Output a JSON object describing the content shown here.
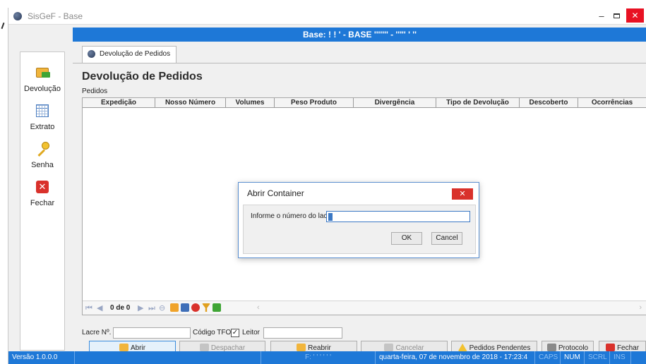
{
  "window": {
    "title": "SisGeF - Base",
    "controls": {
      "minimize": "–",
      "close": "✕"
    }
  },
  "base_header": "Base: ! ! ' - BASE ''''''' - ''''' ' ''",
  "left_nav": [
    {
      "label": "Devolução",
      "icon": "folder-arrow-icon"
    },
    {
      "label": "Extrato",
      "icon": "grid-icon"
    },
    {
      "label": "Senha",
      "icon": "key-icon"
    },
    {
      "label": "Fechar",
      "icon": "close-square-icon"
    }
  ],
  "tab": {
    "label": "Devolução de Pedidos"
  },
  "main": {
    "title": "Devolução de Pedidos",
    "section_label": "Pedidos"
  },
  "grid": {
    "columns": [
      "Expedição",
      "Nosso Número",
      "Volumes",
      "Peso Produto",
      "Divergência",
      "Tipo de Devolução",
      "Descoberto",
      "Ocorrências"
    ],
    "rows": [],
    "record_counter": "0 de 0"
  },
  "form": {
    "lacre_label": "Lacre Nº.",
    "lacre_value": "",
    "codigo_tfo_label": "Código TFO",
    "leitor_label": "Leitor",
    "leitor_checked": true,
    "leitor_value": ""
  },
  "actions": [
    {
      "label": "Abrir",
      "enabled": true
    },
    {
      "label": "Despachar",
      "enabled": false
    },
    {
      "label": "Reabrir",
      "enabled": true
    },
    {
      "label": "Cancelar",
      "enabled": false
    },
    {
      "label": "Pedidos Pendentes",
      "enabled": true
    },
    {
      "label": "Protocolo",
      "enabled": true
    },
    {
      "label": "Fechar",
      "enabled": true
    }
  ],
  "status_bar": {
    "version": "Versão 1.0.0.0",
    "user": "F: ' ' ' ' ' '",
    "datetime": "quarta-feira, 07 de novembro de 2018 - 17:23:4",
    "caps": "CAPS",
    "num": "NUM",
    "scrl": "SCRL",
    "ins": "INS"
  },
  "dialog": {
    "title": "Abrir Container",
    "close": "✕",
    "prompt": "Informe o número do lacre",
    "input_value": "",
    "ok_label": "OK",
    "cancel_label": "Cancel"
  },
  "colors": {
    "accent_blue": "#1e78d7",
    "close_red": "#e81123",
    "panel_bg": "#f0f0f0"
  }
}
